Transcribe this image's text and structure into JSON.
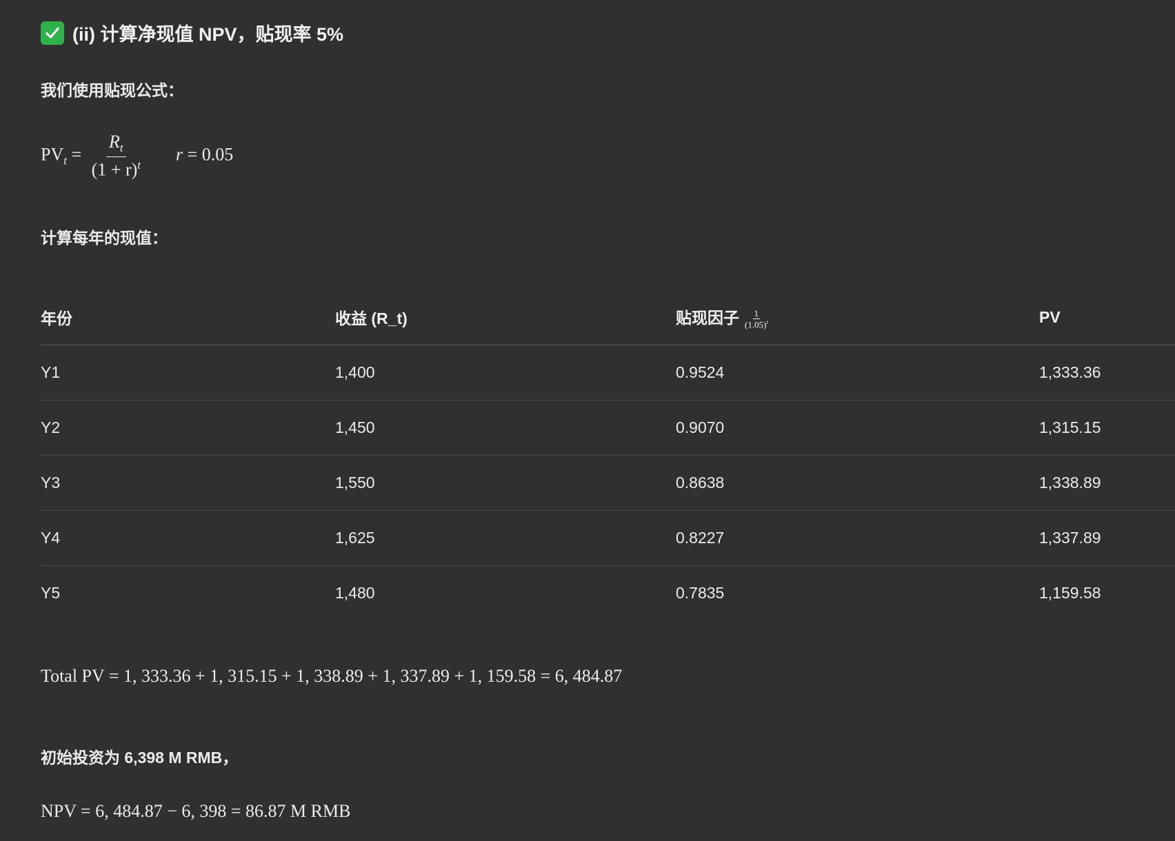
{
  "heading": {
    "icon": "check-mark-icon",
    "text": "(ii) 计算净现值 NPV，贴现率 5%",
    "icon_color": "#2fb24c"
  },
  "intro_text": "我们使用贴现公式：",
  "formula": {
    "lhs": "PV",
    "lhs_sub": "t",
    "equals": "=",
    "numerator": "R",
    "numerator_sub": "t",
    "denominator": "(1 + r)",
    "denominator_sup": "t",
    "rate_var": "r",
    "rate_value": "= 0.05"
  },
  "per_year_text": "计算每年的现值：",
  "table": {
    "headers": {
      "year": "年份",
      "revenue": "收益 (R_t)",
      "factor": "贴现因子",
      "factor_num": "1",
      "factor_den": "(1.05)",
      "factor_den_sup": "t",
      "pv": "PV"
    },
    "rows": [
      {
        "year": "Y1",
        "revenue": "1,400",
        "factor": "0.9524",
        "pv": "1,333.36"
      },
      {
        "year": "Y2",
        "revenue": "1,450",
        "factor": "0.9070",
        "pv": "1,315.15"
      },
      {
        "year": "Y3",
        "revenue": "1,550",
        "factor": "0.8638",
        "pv": "1,338.89"
      },
      {
        "year": "Y4",
        "revenue": "1,625",
        "factor": "0.8227",
        "pv": "1,337.89"
      },
      {
        "year": "Y5",
        "revenue": "1,480",
        "factor": "0.7835",
        "pv": "1,159.58"
      }
    ]
  },
  "total_formula": "Total PV = 1, 333.36 + 1, 315.15 + 1, 338.89 + 1, 337.89 + 1, 159.58 = 6, 484.87",
  "initial_text": "初始投资为 6,398 M RMB，",
  "npv_formula": "NPV = 6, 484.87 − 6, 398 =  86.87 M RMB"
}
